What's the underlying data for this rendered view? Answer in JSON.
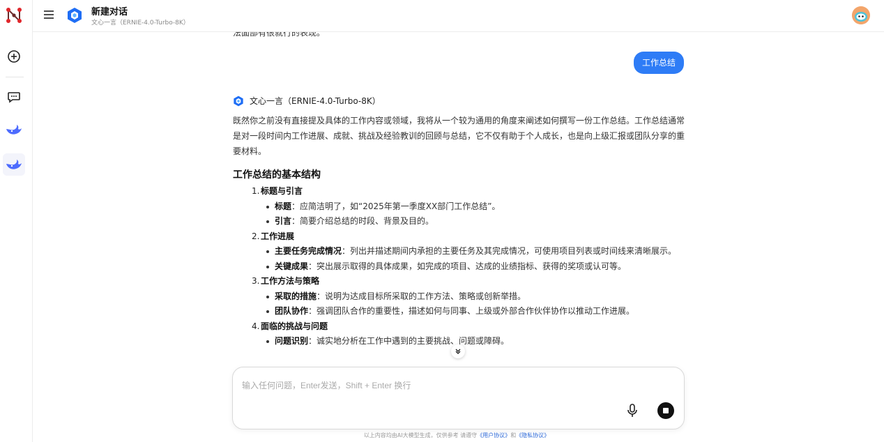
{
  "header": {
    "title": "新建对话",
    "subtitle": "文心一言（ERNIE-4.0-Turbo-8K）"
  },
  "chat": {
    "cut_line": "法面部有很就行的表现。",
    "user_message": "工作总结",
    "bot_name": "文心一言（ERNIE-4.0-Turbo-8K）",
    "intro": "既然你之前没有直接提及具体的工作内容或领域，我将从一个较为通用的角度来阐述如何撰写一份工作总结。工作总结通常是对一段时间内工作进展、成就、挑战及经验教训的回顾与总结，它不仅有助于个人成长，也是向上级汇报或团队分享的重要材料。",
    "heading": "工作总结的基本结构",
    "sections": [
      {
        "num": "1.",
        "title": "标题与引言",
        "items": [
          {
            "key": "标题",
            "text": "：应简洁明了，如“2025年第一季度XX部门工作总结”。"
          },
          {
            "key": "引言",
            "text": "：简要介绍总结的时段、背景及目的。"
          }
        ]
      },
      {
        "num": "2.",
        "title": "工作进展",
        "items": [
          {
            "key": "主要任务完成情况",
            "text": "：列出并描述期间内承担的主要任务及其完成情况，可使用项目列表或时间线来清晰展示。"
          },
          {
            "key": "关键成果",
            "text": "：突出展示取得的具体成果，如完成的项目、达成的业绩指标、获得的奖项或认可等。"
          }
        ]
      },
      {
        "num": "3.",
        "title": "工作方法与策略",
        "items": [
          {
            "key": "采取的措施",
            "text": "：说明为达成目标所采取的工作方法、策略或创新举措。"
          },
          {
            "key": "团队协作",
            "text": "：强调团队合作的重要性，描述如何与同事、上级或外部合作伙伴协作以推动工作进展。"
          }
        ]
      },
      {
        "num": "4.",
        "title": "面临的挑战与问题",
        "items": [
          {
            "key": "问题识别",
            "text": "：诚实地分析在工作中遇到的主要挑战、问题或障碍。"
          }
        ]
      }
    ]
  },
  "input": {
    "placeholder": "输入任何问题，Enter发送，Shift + Enter 换行"
  },
  "footer": {
    "prefix": "以上内容均由AI大模型生成，仅供参考    请遵守",
    "user_agreement": "《用户协议》",
    "and": "和",
    "privacy": "《隐私协议》"
  },
  "icons": {
    "app_logo": "app-logo-icon",
    "new_chat": "plus-circle-icon",
    "chat_list": "chat-bubble-icon",
    "deepseek": "whale-icon",
    "menu": "hamburger-icon",
    "mic": "microphone-icon",
    "stop": "stop-icon",
    "scroll": "chevron-down-icon"
  },
  "colors": {
    "accent": "#2e7cf6",
    "brand_red": "#e0262b",
    "whale_blue": "#4d6bfe"
  }
}
